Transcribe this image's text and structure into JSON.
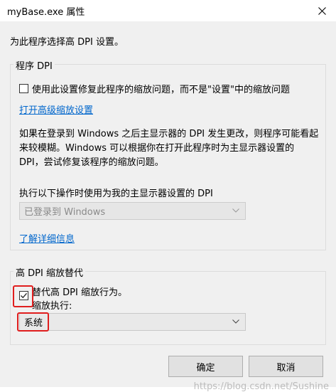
{
  "window": {
    "title": "myBase.exe 属性"
  },
  "intro_text": "为此程序选择高 DPI 设置。",
  "program_dpi": {
    "legend": "程序 DPI",
    "checkbox_label": "使用此设置修复此程序的缩放问题，而不是\"设置\"中的缩放问题",
    "checkbox_checked": false,
    "advanced_link": "打开高级缩放设置",
    "description": "如果在登录到 Windows 之后主显示器的 DPI 发生更改，则程序可能看起来较模糊。Windows 可以根据你在打开此程序时为主显示器设置的 DPI，尝试修复该程序的缩放问题。",
    "select_label": "执行以下操作时使用为我的主显示器设置的 DPI",
    "select_value": "已登录到 Windows",
    "learn_more_link": "了解详细信息"
  },
  "high_dpi_override": {
    "legend": "高 DPI 缩放替代",
    "checkbox_label": "替代高 DPI 缩放行为。",
    "checkbox_checked": true,
    "sub_label": "缩放执行:",
    "select_value": "系统"
  },
  "buttons": {
    "ok": "确定",
    "cancel": "取消"
  },
  "watermark": "https://blog.csdn.net/Sushine"
}
